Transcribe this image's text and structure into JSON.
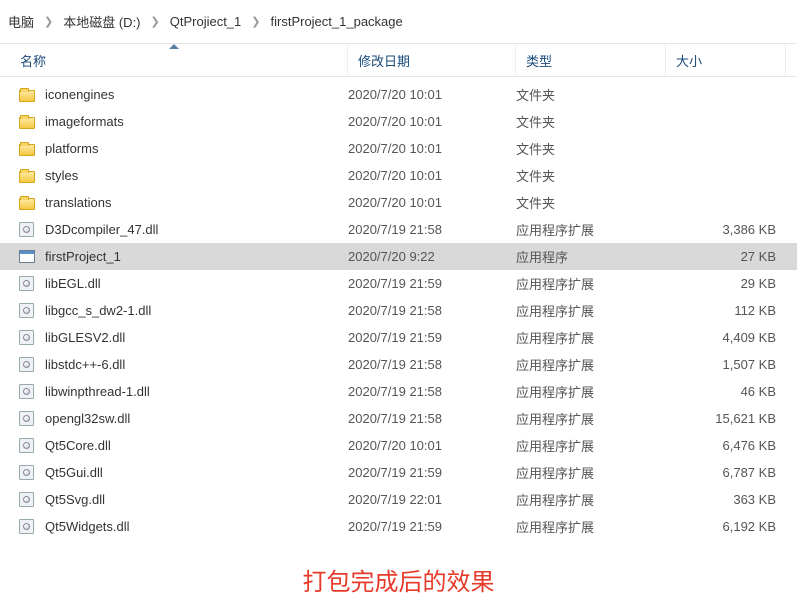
{
  "breadcrumb": {
    "items": [
      {
        "label": "电脑"
      },
      {
        "label": "本地磁盘 (D:)"
      },
      {
        "label": "QtProjiect_1"
      },
      {
        "label": "firstProject_1_package"
      }
    ]
  },
  "columns": {
    "name": "名称",
    "date": "修改日期",
    "type": "类型",
    "size": "大小"
  },
  "rows": [
    {
      "icon": "folder",
      "name": "iconengines",
      "date": "2020/7/20 10:01",
      "type": "文件夹",
      "size": "",
      "selected": false
    },
    {
      "icon": "folder",
      "name": "imageformats",
      "date": "2020/7/20 10:01",
      "type": "文件夹",
      "size": "",
      "selected": false
    },
    {
      "icon": "folder",
      "name": "platforms",
      "date": "2020/7/20 10:01",
      "type": "文件夹",
      "size": "",
      "selected": false
    },
    {
      "icon": "folder",
      "name": "styles",
      "date": "2020/7/20 10:01",
      "type": "文件夹",
      "size": "",
      "selected": false
    },
    {
      "icon": "folder",
      "name": "translations",
      "date": "2020/7/20 10:01",
      "type": "文件夹",
      "size": "",
      "selected": false
    },
    {
      "icon": "dll",
      "name": "D3Dcompiler_47.dll",
      "date": "2020/7/19 21:58",
      "type": "应用程序扩展",
      "size": "3,386 KB",
      "selected": false
    },
    {
      "icon": "exe",
      "name": "firstProject_1",
      "date": "2020/7/20 9:22",
      "type": "应用程序",
      "size": "27 KB",
      "selected": true
    },
    {
      "icon": "dll",
      "name": "libEGL.dll",
      "date": "2020/7/19 21:59",
      "type": "应用程序扩展",
      "size": "29 KB",
      "selected": false
    },
    {
      "icon": "dll",
      "name": "libgcc_s_dw2-1.dll",
      "date": "2020/7/19 21:58",
      "type": "应用程序扩展",
      "size": "112 KB",
      "selected": false
    },
    {
      "icon": "dll",
      "name": "libGLESV2.dll",
      "date": "2020/7/19 21:59",
      "type": "应用程序扩展",
      "size": "4,409 KB",
      "selected": false
    },
    {
      "icon": "dll",
      "name": "libstdc++-6.dll",
      "date": "2020/7/19 21:58",
      "type": "应用程序扩展",
      "size": "1,507 KB",
      "selected": false
    },
    {
      "icon": "dll",
      "name": "libwinpthread-1.dll",
      "date": "2020/7/19 21:58",
      "type": "应用程序扩展",
      "size": "46 KB",
      "selected": false
    },
    {
      "icon": "dll",
      "name": "opengl32sw.dll",
      "date": "2020/7/19 21:58",
      "type": "应用程序扩展",
      "size": "15,621 KB",
      "selected": false
    },
    {
      "icon": "dll",
      "name": "Qt5Core.dll",
      "date": "2020/7/20 10:01",
      "type": "应用程序扩展",
      "size": "6,476 KB",
      "selected": false
    },
    {
      "icon": "dll",
      "name": "Qt5Gui.dll",
      "date": "2020/7/19 21:59",
      "type": "应用程序扩展",
      "size": "6,787 KB",
      "selected": false
    },
    {
      "icon": "dll",
      "name": "Qt5Svg.dll",
      "date": "2020/7/19 22:01",
      "type": "应用程序扩展",
      "size": "363 KB",
      "selected": false
    },
    {
      "icon": "dll",
      "name": "Qt5Widgets.dll",
      "date": "2020/7/19 21:59",
      "type": "应用程序扩展",
      "size": "6,192 KB",
      "selected": false
    }
  ],
  "caption": "打包完成后的效果"
}
